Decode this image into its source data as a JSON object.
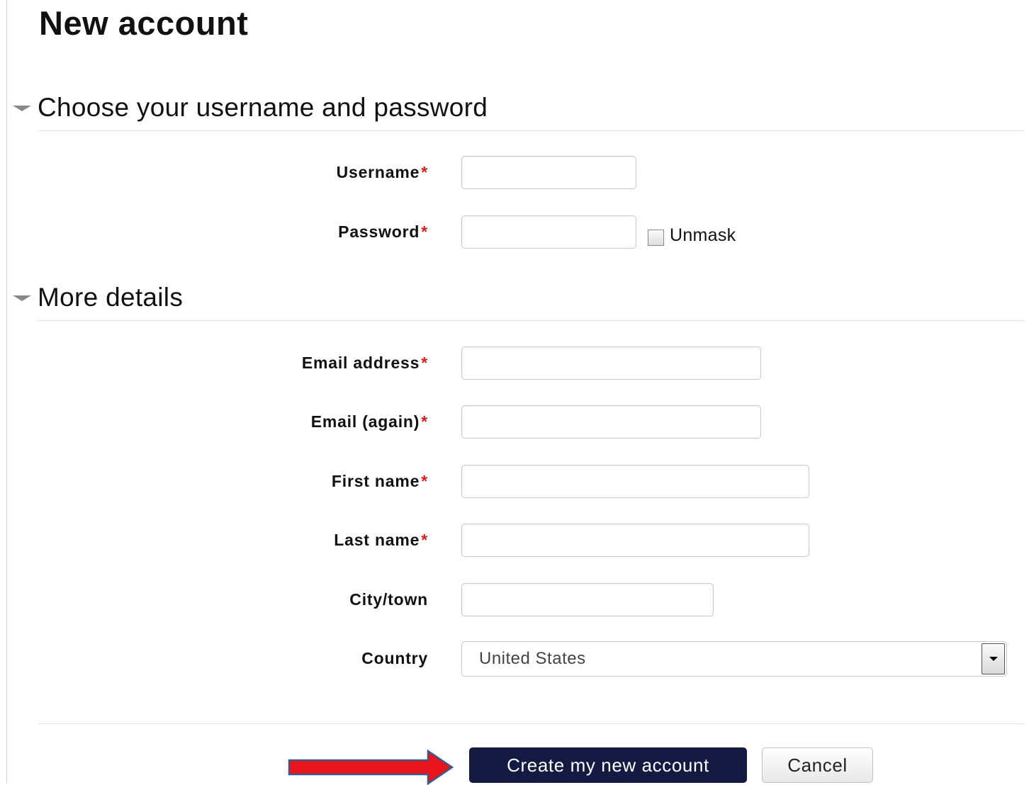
{
  "page": {
    "title": "New account"
  },
  "sections": {
    "credentials": {
      "title": "Choose your username and password",
      "username_label": "Username",
      "password_label": "Password",
      "unmask_label": "Unmask",
      "unmask_checked": false
    },
    "details": {
      "title": "More details",
      "email_label": "Email address",
      "email_again_label": "Email (again)",
      "first_name_label": "First name",
      "last_name_label": "Last name",
      "city_label": "City/town",
      "country_label": "Country",
      "country_value": "United States"
    }
  },
  "required_marker": "*",
  "actions": {
    "submit_label": "Create my new account",
    "cancel_label": "Cancel"
  },
  "colors": {
    "primary_button": "#141a42",
    "required": "#d21f1f",
    "annotation_arrow": "#e8141c"
  },
  "icons": {
    "section_toggle": "triangle-down-icon",
    "select_arrow": "chevron-down-icon",
    "annotation": "right-arrow-icon"
  }
}
